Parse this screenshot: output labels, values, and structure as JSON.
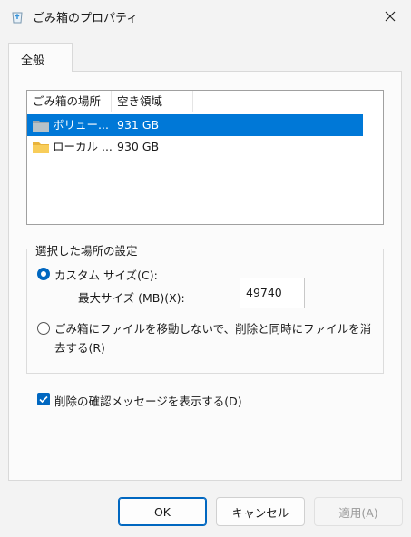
{
  "window": {
    "title": "ごみ箱のプロパティ"
  },
  "tabs": [
    {
      "label": "全般"
    }
  ],
  "list": {
    "columns": [
      "ごみ箱の場所",
      "空き領域"
    ],
    "rows": [
      {
        "name": "ボリュー...",
        "space": "931 GB",
        "icon": "folder-gray-icon",
        "selected": true
      },
      {
        "name": "ローカル ...",
        "space": "930 GB",
        "icon": "folder-yellow-icon",
        "selected": false
      }
    ]
  },
  "settings": {
    "group_title": "選択した場所の設定",
    "custom_size_label": "カスタム サイズ(C):",
    "max_size_label": "最大サイズ (MB)(X):",
    "max_size_value": "49740",
    "no_move_label_line1": "ごみ箱にファイルを移動しないで、削除と同時にファイルを消",
    "no_move_label_line2": "去する(R)"
  },
  "confirm_checkbox": {
    "label": "削除の確認メッセージを表示する(D)",
    "checked": true
  },
  "buttons": {
    "ok": "OK",
    "cancel": "キャンセル",
    "apply": "適用(A)"
  },
  "colors": {
    "accent": "#0067c0",
    "selection": "#0078d7"
  }
}
